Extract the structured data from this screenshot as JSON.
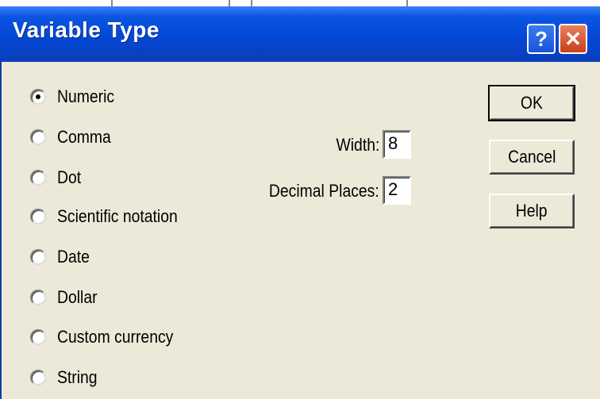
{
  "window": {
    "title": "Variable Type",
    "help_icon": "question-icon",
    "close_icon": "close-icon",
    "help_glyph": "?",
    "close_glyph": "✕"
  },
  "types": {
    "selected": "Numeric",
    "options": [
      {
        "label": "Numeric",
        "checked": true
      },
      {
        "label": "Comma",
        "checked": false
      },
      {
        "label": "Dot",
        "checked": false
      },
      {
        "label": "Scientific notation",
        "checked": false
      },
      {
        "label": "Date",
        "checked": false
      },
      {
        "label": "Dollar",
        "checked": false
      },
      {
        "label": "Custom currency",
        "checked": false
      },
      {
        "label": "String",
        "checked": false
      }
    ]
  },
  "fields": {
    "width_label": "Width:",
    "width_value": "8",
    "decimals_label": "Decimal Places:",
    "decimals_value": "2"
  },
  "buttons": {
    "ok": "OK",
    "cancel": "Cancel",
    "help": "Help"
  }
}
